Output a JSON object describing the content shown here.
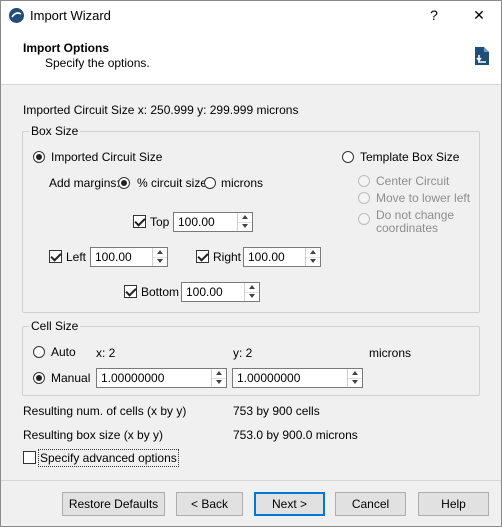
{
  "window": {
    "title": "Import Wizard",
    "help_glyph": "?",
    "close_glyph": "✕"
  },
  "header": {
    "title": "Import Options",
    "subtitle": "Specify the options.",
    "icon": "document-import-icon"
  },
  "imported_size": {
    "label": "Imported Circuit Size  x: 250.999  y: 299.999  microns"
  },
  "box_size": {
    "title": "Box Size",
    "imported_option": "Imported Circuit Size",
    "imported_checked": true,
    "template_option": "Template Box Size",
    "template_checked": false,
    "add_margins_label": "Add margins:",
    "pct_option": "% circuit size",
    "pct_checked": true,
    "microns_option": "microns",
    "microns_checked": false,
    "template_choices": {
      "center": "Center Circuit",
      "move": "Move to lower left",
      "no_change_line1": "Do not change",
      "no_change_line2": "coordinates"
    },
    "margins": {
      "top": {
        "label": "Top",
        "value": "100.00",
        "checked": true
      },
      "left": {
        "label": "Left",
        "value": "100.00",
        "checked": true
      },
      "right": {
        "label": "Right",
        "value": "100.00",
        "checked": true
      },
      "bottom": {
        "label": "Bottom",
        "value": "100.00",
        "checked": true
      }
    }
  },
  "cell_size": {
    "title": "Cell Size",
    "auto_label": "Auto",
    "auto_checked": false,
    "auto_x": "x: 2",
    "auto_y": "y: 2",
    "units": "microns",
    "manual_label": "Manual",
    "manual_checked": true,
    "manual_x": "1.00000000",
    "manual_y": "1.00000000"
  },
  "results": {
    "cells_label": "Resulting num. of cells (x by y)",
    "cells_value": "753 by 900 cells",
    "box_label": "Resulting box size (x by y)",
    "box_value": "753.0 by 900.0  microns"
  },
  "advanced": {
    "label": "Specify advanced options",
    "checked": false
  },
  "buttons": {
    "restore": "Restore Defaults",
    "back": "< Back",
    "next": "Next >",
    "cancel": "Cancel",
    "help": "Help"
  }
}
